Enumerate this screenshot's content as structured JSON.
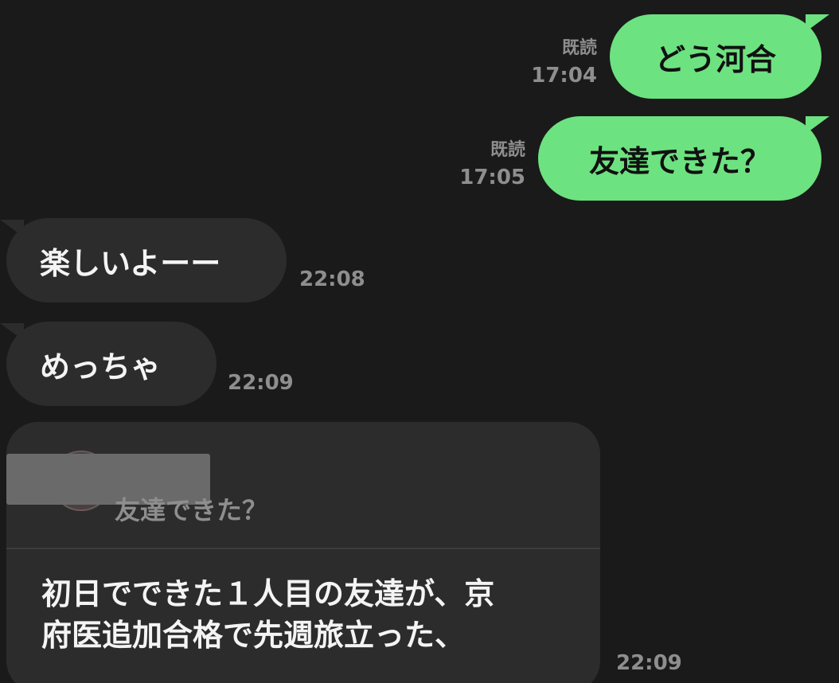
{
  "messages": {
    "sent1": {
      "text": "どう河合",
      "read": "既読",
      "time": "17:04"
    },
    "sent2": {
      "text": "友達できた？",
      "read": "既読",
      "time": "17:05"
    },
    "recv1": {
      "text": "楽しいよーー",
      "time": "22:08"
    },
    "recv2": {
      "text": "めっちゃ",
      "time": "22:09"
    },
    "reply": {
      "quoted_text": "友達できた？",
      "line1": "初日でできた１人目の友達が、京",
      "line2": "府医追加合格で先週旅立った、",
      "time": "22:09"
    }
  },
  "colors": {
    "background": "#1a1a1a",
    "sent_bubble": "#6de280",
    "recv_bubble": "#2c2c2c",
    "meta_text": "#8e8e8e"
  }
}
